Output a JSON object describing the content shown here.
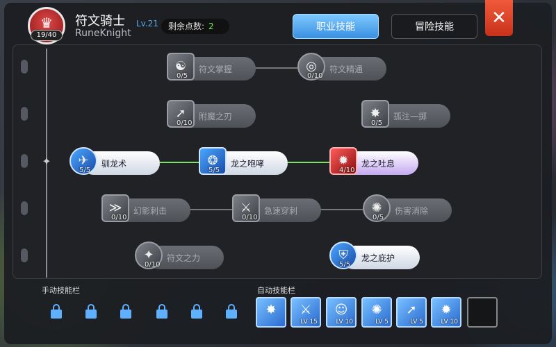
{
  "header": {
    "level_progress": "19/40",
    "class_name": "符文骑士",
    "class_name_en": "RuneKnight",
    "char_level": "Lv.21",
    "points_label": "剩余点数:",
    "points_value": "2"
  },
  "tabs": {
    "job": "职业技能",
    "adventure": "冒险技能"
  },
  "close_label": "✕",
  "skills": [
    {
      "name": "符文掌握",
      "level": "0/5",
      "glyph": "☯"
    },
    {
      "name": "符文精通",
      "level": "0/10",
      "glyph": "◎"
    },
    {
      "name": "附魔之刃",
      "level": "0/10",
      "glyph": "➚"
    },
    {
      "name": "孤注一掷",
      "level": "0/5",
      "glyph": "✸"
    },
    {
      "name": "驯龙术",
      "level": "5/5",
      "glyph": "✈"
    },
    {
      "name": "龙之咆哮",
      "level": "5/5",
      "glyph": "❂"
    },
    {
      "name": "龙之吐息",
      "level": "4/10",
      "glyph": "✹"
    },
    {
      "name": "幻影刺击",
      "level": "0/10",
      "glyph": "≫"
    },
    {
      "name": "急速穿刺",
      "level": "0/10",
      "glyph": "⚔"
    },
    {
      "name": "伤害消除",
      "level": "0/5",
      "glyph": "✺"
    },
    {
      "name": "符文之力",
      "level": "0/10",
      "glyph": "✦"
    },
    {
      "name": "龙之庇护",
      "level": "5/5",
      "glyph": "⛨"
    }
  ],
  "manual_bar": {
    "label": "手动技能栏"
  },
  "auto_bar": {
    "label": "自动技能栏",
    "slots": [
      {
        "glyph": "✸",
        "level": ""
      },
      {
        "glyph": "⚔",
        "level": "LV 15"
      },
      {
        "glyph": "☺",
        "level": "LV 10"
      },
      {
        "glyph": "✺",
        "level": "LV 5"
      },
      {
        "glyph": "➚",
        "level": "LV 5"
      },
      {
        "glyph": "✹",
        "level": "LV 10"
      }
    ]
  }
}
